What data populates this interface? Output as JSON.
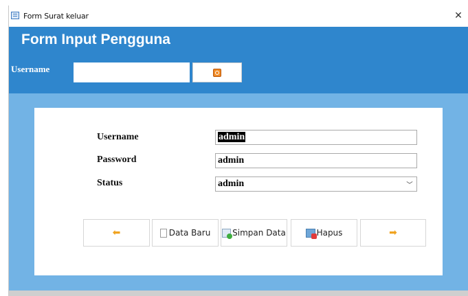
{
  "window": {
    "title": "Form Surat keluar",
    "close_glyph": "✕",
    "icon": "form-icon"
  },
  "header": {
    "form_title": "Form Input Pengguna",
    "search_label": "Username",
    "search_value": "",
    "search_button_icon": "search-icon"
  },
  "form": {
    "fields": [
      {
        "label": "Username",
        "value": "admin",
        "selected": true
      },
      {
        "label": "Password",
        "value": "admin"
      },
      {
        "label": "Status",
        "value": "admin",
        "type": "select"
      }
    ],
    "select_arrow": "﹀"
  },
  "buttons": {
    "prev_glyph": "⬅",
    "new_label": "Data Baru",
    "save_label": "Simpan Data",
    "delete_label": "Hapus",
    "next_glyph": "➡"
  },
  "colors": {
    "header_blue": "#2f86cd",
    "panel_blue": "#72b3e5",
    "arrow_orange": "#f0a320"
  }
}
